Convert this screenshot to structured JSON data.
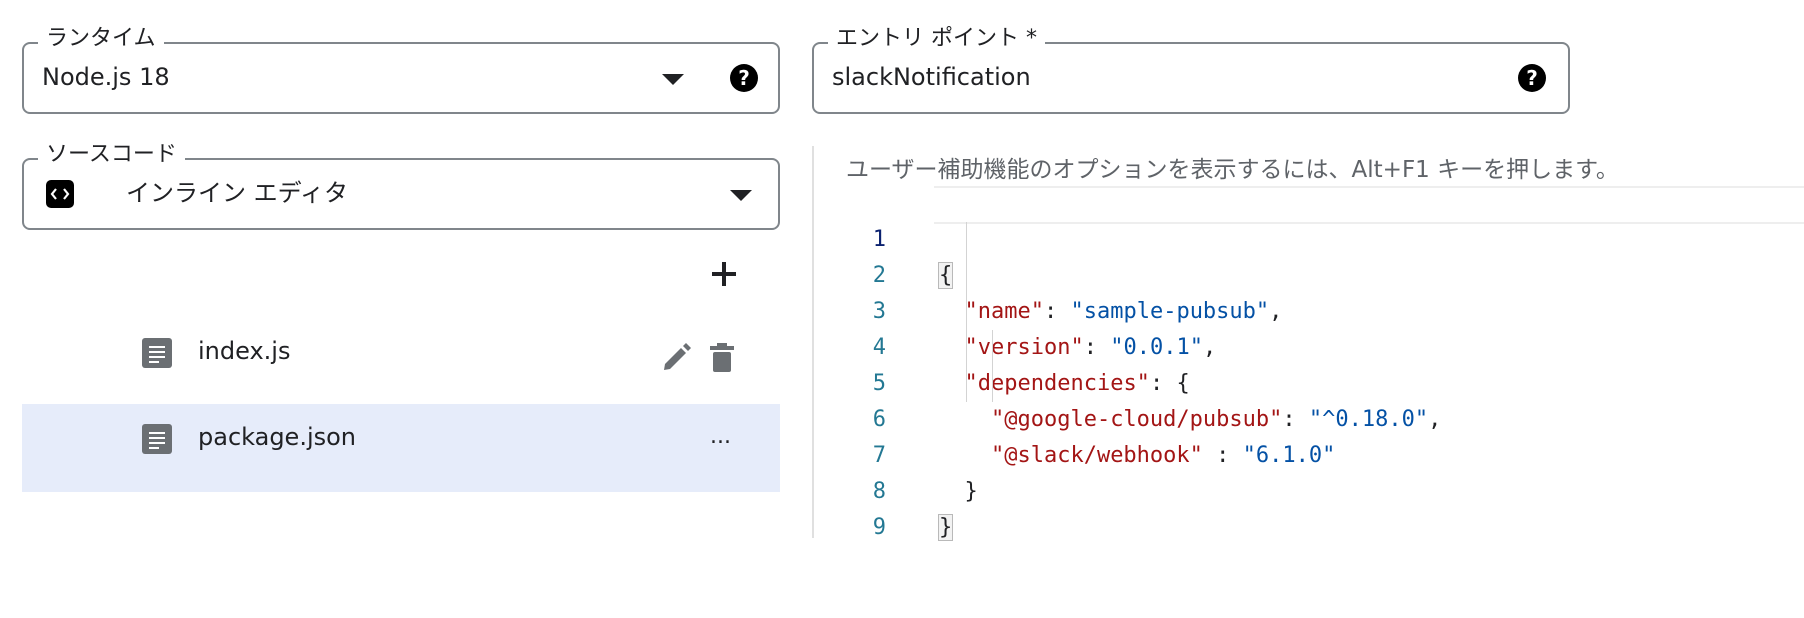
{
  "runtime": {
    "label": "ランタイム",
    "value": "Node.js 18"
  },
  "entry_point": {
    "label": "エントリ ポイント *",
    "value": "slackNotification"
  },
  "source_code": {
    "label": "ソースコード",
    "value": "インライン エディタ"
  },
  "add_icon": "plus-icon",
  "files": [
    {
      "name": "index.js",
      "actions": [
        "edit",
        "delete"
      ]
    },
    {
      "name": "package.json",
      "more": "..."
    }
  ],
  "editor": {
    "hint": "ユーザー補助機能のオプションを表示するには、Alt+F1 キーを押します。",
    "lines": [
      {
        "n": "1",
        "text": "{"
      },
      {
        "n": "2",
        "key": "\"name\"",
        "sep": ": ",
        "val": "\"sample-pubsub\"",
        "end": ","
      },
      {
        "n": "3",
        "key": "\"version\"",
        "sep": ": ",
        "val": "\"0.0.1\"",
        "end": ","
      },
      {
        "n": "4",
        "key": "\"dependencies\"",
        "sep": ": ",
        "val": "",
        "end": "{"
      },
      {
        "n": "5",
        "key": "\"@google-cloud/pubsub\"",
        "sep": ": ",
        "val": "\"^0.18.0\"",
        "end": ","
      },
      {
        "n": "6",
        "key": "\"@slack/webhook\"",
        "sep": " : ",
        "val": "\"6.1.0\"",
        "end": ""
      },
      {
        "n": "7",
        "text": "}"
      },
      {
        "n": "8",
        "text": "}"
      },
      {
        "n": "9",
        "text": ""
      }
    ]
  },
  "colors": {
    "key": "#a31515",
    "string": "#0451a5",
    "line_number": "#237893",
    "selected_row": "#e6ecfa"
  }
}
